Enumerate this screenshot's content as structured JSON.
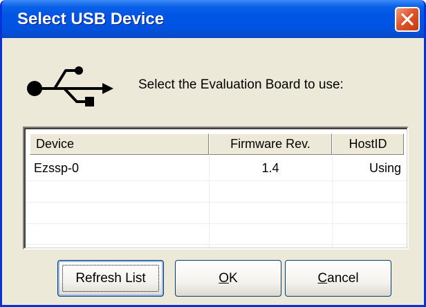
{
  "window": {
    "title": "Select USB Device",
    "title_bar_color": "#0055e5",
    "close_icon": "close-x-icon"
  },
  "header": {
    "icon": "usb-icon",
    "prompt": "Select the Evaluation Board to use:"
  },
  "device_list": {
    "columns": [
      "Device",
      "Firmware Rev.",
      "HostID"
    ],
    "rows": [
      {
        "device": "Ezssp-0",
        "firmware": "1.4",
        "hostid": "Using"
      }
    ]
  },
  "buttons": {
    "refresh": {
      "label": "Refresh List"
    },
    "ok": {
      "mnemonic": "O",
      "rest": "K"
    },
    "cancel": {
      "mnemonic": "C",
      "rest": "ancel"
    }
  }
}
